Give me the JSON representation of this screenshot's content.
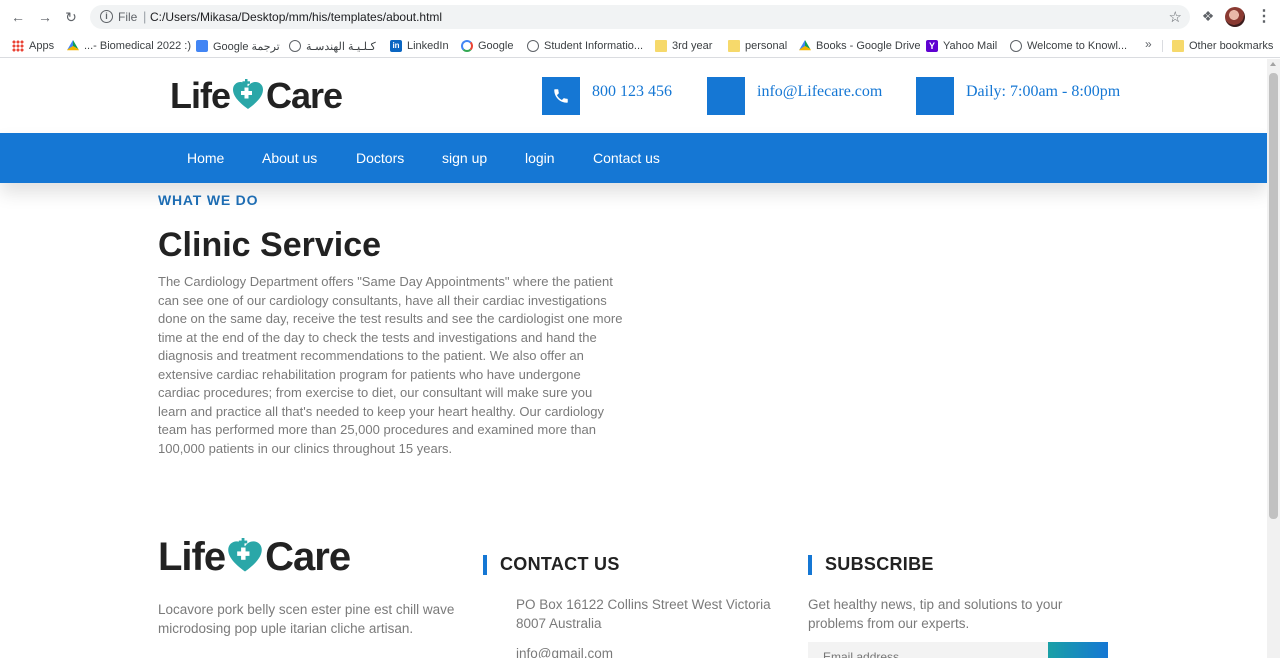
{
  "browser": {
    "file_label": "File",
    "url": "C:/Users/Mikasa/Desktop/mm/his/templates/about.html",
    "bookmarks": [
      {
        "label": "Apps",
        "icon": "apps-grid-icon"
      },
      {
        "label": "...- Biomedical 2022 :)",
        "icon": "google-drive-icon"
      },
      {
        "label": "Google ترجمة",
        "icon": "google-translate-icon"
      },
      {
        "label": "كـلـيـة الهندسـة",
        "icon": "globe-icon"
      },
      {
        "label": "LinkedIn",
        "icon": "linkedin-icon"
      },
      {
        "label": "Google",
        "icon": "google-icon"
      },
      {
        "label": "Student Informatio...",
        "icon": "globe-icon"
      },
      {
        "label": "3rd year",
        "icon": "folder-icon"
      },
      {
        "label": "personal",
        "icon": "folder-icon"
      },
      {
        "label": "Books - Google Drive",
        "icon": "google-drive-icon"
      },
      {
        "label": "Yahoo Mail",
        "icon": "yahoo-icon"
      },
      {
        "label": "Welcome to Knowl...",
        "icon": "globe-icon"
      }
    ],
    "more_label": "»",
    "other_bookmarks": "Other bookmarks"
  },
  "header": {
    "logo_left": "Life",
    "logo_right": "Care",
    "phone": "800 123 456",
    "email": "info@Lifecare.com",
    "hours": "Daily: 7:00am - 8:00pm"
  },
  "nav": {
    "items": [
      "Home",
      "About us",
      "Doctors",
      "sign up",
      "login",
      "Contact us"
    ]
  },
  "content": {
    "eyebrow": "WHAT WE DO",
    "title": "Clinic Service",
    "body": "The Cardiology Department offers \"Same Day Appointments\" where the patient can see one of our cardiology consultants, have all their cardiac investigations done on the same day, receive the test results and see the cardiologist one more time at the end of the day to check the tests and investigations and hand the diagnosis and treatment recommendations to the patient. We also offer an extensive cardiac rehabilitation program for patients who have undergone cardiac procedures; from exercise to diet, our consultant will make sure you learn and practice all that's needed to keep your heart healthy. Our cardiology team has performed more than 25,000 procedures and examined more than 100,000 patients in our clinics throughout 15 years."
  },
  "footer": {
    "logo_left": "Life",
    "logo_right": "Care",
    "about": "Locavore pork belly scen ester pine est chill wave microdosing pop uple itarian cliche artisan.",
    "contact_heading": "CONTACT US",
    "address": "PO Box 16122 Collins Street West Victoria 8007 Australia",
    "email": "info@gmail.com",
    "subscribe_heading": "SUBSCRIBE",
    "subscribe_text": "Get healthy news, tip and solutions to your problems from our experts.",
    "email_placeholder": "Email address"
  },
  "colors": {
    "brand_blue": "#1577d4",
    "logo_teal": "#2aa7a8"
  }
}
